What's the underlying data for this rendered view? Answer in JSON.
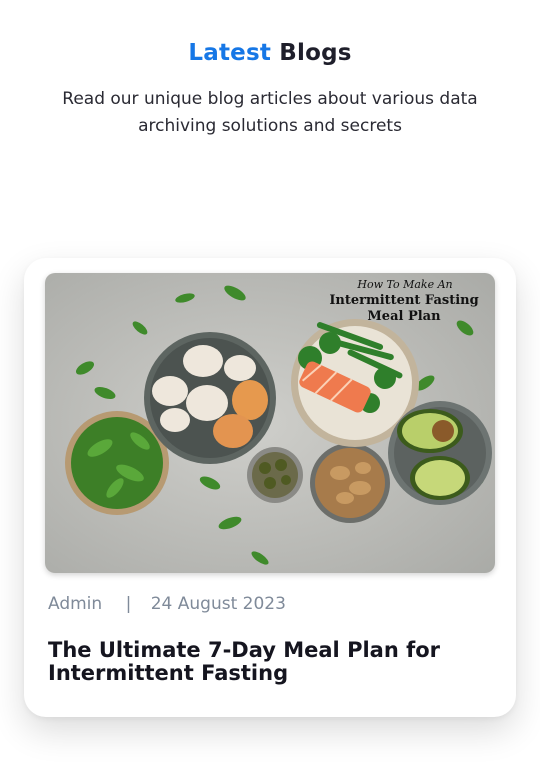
{
  "header": {
    "title_accent": "Latest",
    "title_rest": "Blogs",
    "subtitle": "Read our unique blog articles about various data archiving solutions and secrets",
    "accent_color": "#1677e6"
  },
  "post": {
    "author": "Admin",
    "separator": "|",
    "date": "24 August 2023",
    "title": "The Ultimate 7-Day Meal Plan for Intermittent Fasting",
    "image": {
      "line1": "How To Make An",
      "line2": "Intermittent Fasting",
      "line3": "Meal Plan"
    }
  }
}
